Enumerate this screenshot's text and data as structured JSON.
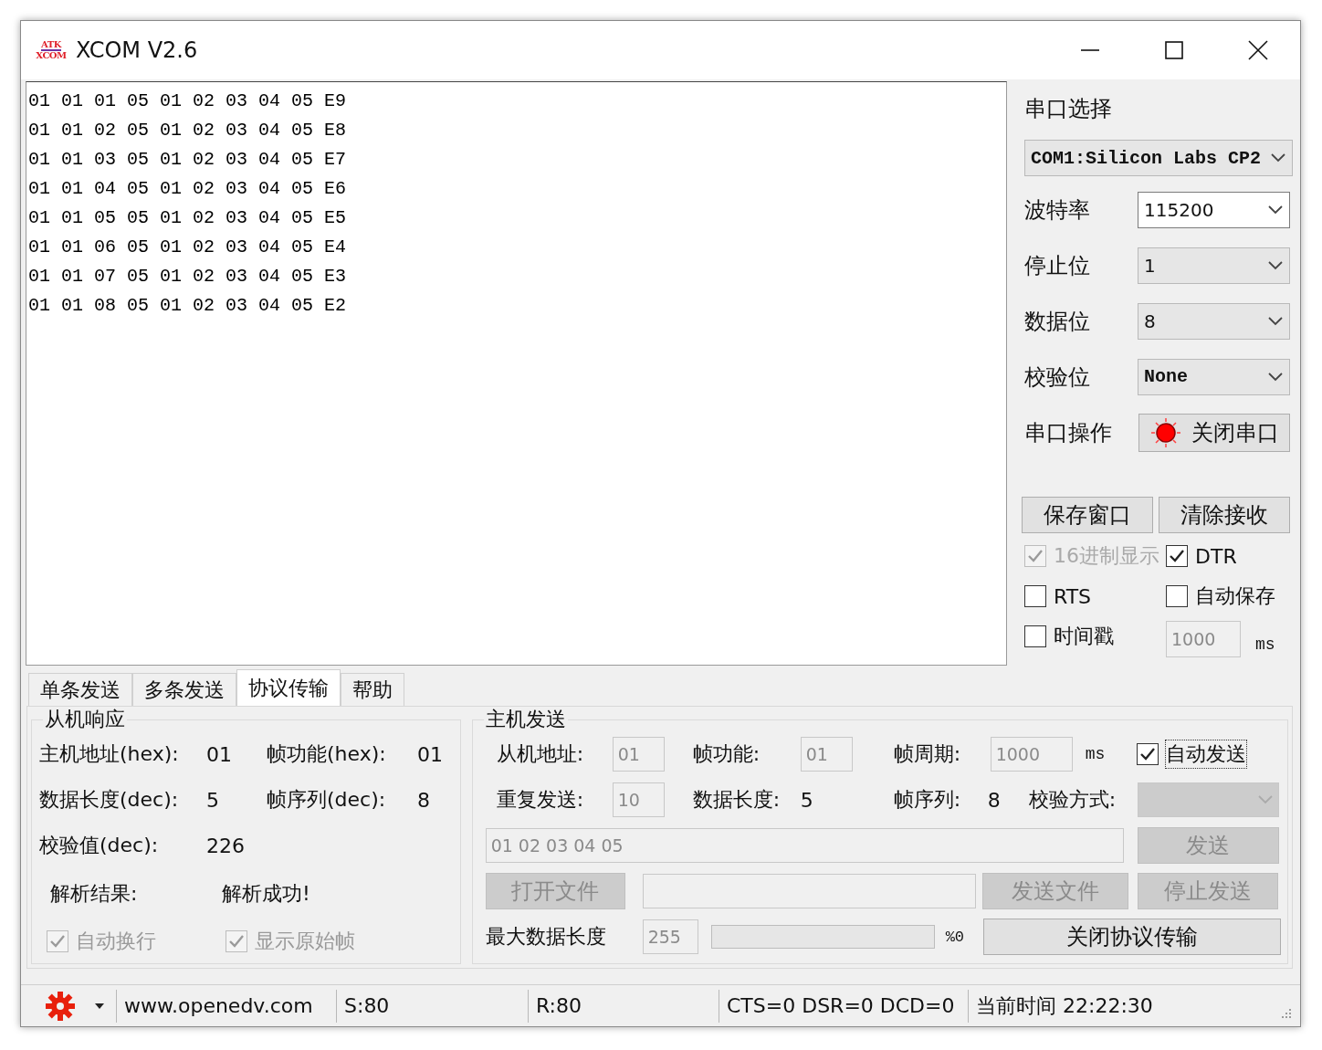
{
  "window": {
    "title": "XCOM V2.6",
    "logo_lines": [
      "ATK",
      "XCOM"
    ]
  },
  "receive_lines": [
    "01 01 01 05 01 02 03 04 05 E9",
    "01 01 02 05 01 02 03 04 05 E8",
    "01 01 03 05 01 02 03 04 05 E7",
    "01 01 04 05 01 02 03 04 05 E6",
    "01 01 05 05 01 02 03 04 05 E5",
    "01 01 06 05 01 02 03 04 05 E4",
    "01 01 07 05 01 02 03 04 05 E3",
    "01 01 08 05 01 02 03 04 05 E2"
  ],
  "serial": {
    "port_label": "串口选择",
    "port": "COM1:Silicon Labs CP2",
    "fields": [
      {
        "label": "波特率",
        "value": "115200",
        "disabled": false
      },
      {
        "label": "停止位",
        "value": "1",
        "disabled": true
      },
      {
        "label": "数据位",
        "value": "8",
        "disabled": true
      },
      {
        "label": "校验位",
        "value": "None",
        "disabled": true
      }
    ],
    "operation_label": "串口操作",
    "toggle_button": "关闭串口",
    "open": true,
    "buttons": [
      "保存窗口",
      "清除接收"
    ],
    "options": [
      {
        "label": "16进制显示",
        "checked": true,
        "disabled": true
      },
      {
        "label": "DTR",
        "checked": true,
        "disabled": false
      },
      {
        "label": "RTS",
        "checked": false,
        "disabled": false
      },
      {
        "label": "自动保存",
        "checked": false,
        "disabled": false
      },
      {
        "label": "时间戳",
        "checked": false,
        "disabled": false
      }
    ],
    "timestamp_value": "1000",
    "timestamp_unit": "ms"
  },
  "tabs": [
    {
      "label": "单条发送",
      "selected": false
    },
    {
      "label": "多条发送",
      "selected": false
    },
    {
      "label": "协议传输",
      "selected": true
    },
    {
      "label": "帮助",
      "selected": false
    }
  ],
  "slave_response": {
    "title": "从机响应",
    "fields": [
      {
        "label": "主机地址(hex):",
        "value": "01"
      },
      {
        "label": "帧功能(hex):",
        "value": "01"
      },
      {
        "label": "数据长度(dec):",
        "value": "5"
      },
      {
        "label": "帧序列(dec):",
        "value": "8"
      },
      {
        "label": "校验值(dec):",
        "value": "226"
      }
    ],
    "result_label": "解析结果:",
    "result": "解析成功!",
    "options": [
      {
        "label": "自动换行",
        "checked": true,
        "disabled": true
      },
      {
        "label": "显示原始帧",
        "checked": true,
        "disabled": true
      }
    ]
  },
  "host_send": {
    "title": "主机发送",
    "slave_address_label": "从机地址:",
    "slave_address": "01",
    "function_label": "帧功能:",
    "function": "01",
    "period_label": "帧周期:",
    "period": "1000",
    "period_unit": "ms",
    "auto_send": {
      "label": "自动发送",
      "checked": true
    },
    "repeat_label": "重复发送:",
    "repeat": "10",
    "length_label": "数据长度:",
    "length": "5",
    "sequence_label": "帧序列:",
    "sequence": "8",
    "checksum_label": "校验方式:",
    "data": "01 02 03 04 05",
    "send_button": {
      "label": "发送",
      "disabled": true
    },
    "open_file_button": {
      "label": "打开文件",
      "disabled": true
    },
    "send_file_button": {
      "label": "发送文件",
      "disabled": true
    },
    "stop_button": {
      "label": "停止发送",
      "disabled": true
    },
    "max_length_label": "最大数据长度",
    "max_length": "255",
    "progress": {
      "level": 0,
      "reading": "%0"
    },
    "close_button": {
      "label": "关闭协议传输",
      "disabled": false
    }
  },
  "status_bar": {
    "website": "www.openedv.com",
    "sent": "S:80",
    "received": "R:80",
    "lines": "CTS=0 DSR=0 DCD=0",
    "time": "当前时间 22:22:30"
  }
}
